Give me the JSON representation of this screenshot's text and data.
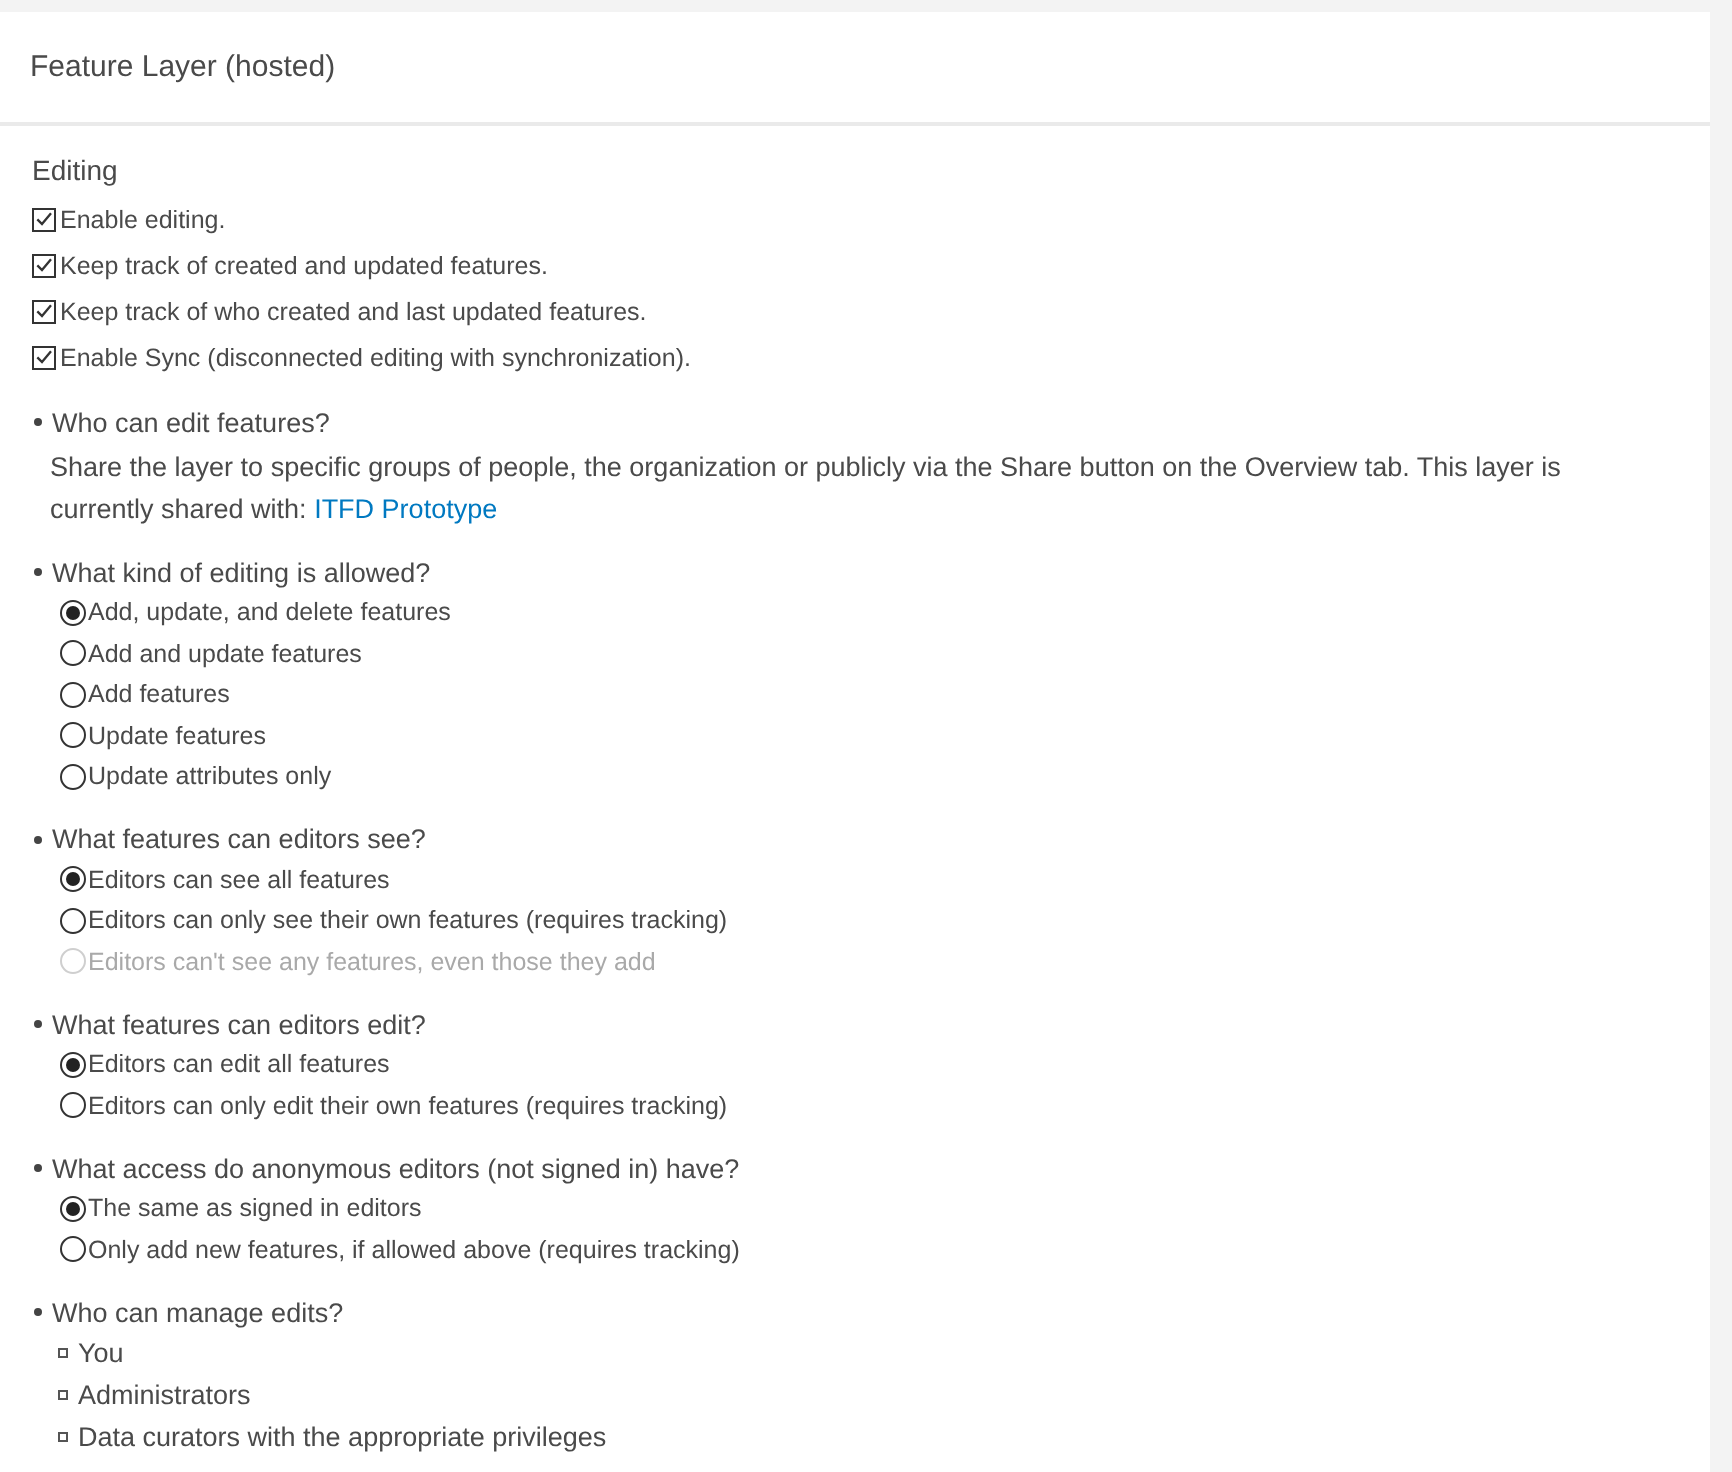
{
  "header": {
    "title": "Feature Layer (hosted)"
  },
  "editing": {
    "title": "Editing",
    "checkboxes": [
      {
        "label": "Enable editing.",
        "checked": true
      },
      {
        "label": "Keep track of created and updated features.",
        "checked": true
      },
      {
        "label": "Keep track of who created and last updated features.",
        "checked": true
      },
      {
        "label": "Enable Sync (disconnected editing with synchronization).",
        "checked": true
      }
    ]
  },
  "questions": [
    {
      "kind": "text",
      "question": "Who can edit features?",
      "description": "Share the layer to specific groups of people, the organization or publicly via the Share button on the Overview tab. This layer is currently shared with:",
      "link": "ITFD Prototype"
    },
    {
      "kind": "radios",
      "question": "What kind of editing is allowed?",
      "options": [
        {
          "label": "Add, update, and delete features",
          "selected": true,
          "disabled": false
        },
        {
          "label": "Add and update features",
          "selected": false,
          "disabled": false
        },
        {
          "label": "Add features",
          "selected": false,
          "disabled": false
        },
        {
          "label": "Update features",
          "selected": false,
          "disabled": false
        },
        {
          "label": "Update attributes only",
          "selected": false,
          "disabled": false
        }
      ]
    },
    {
      "kind": "radios",
      "question": "What features can editors see?",
      "options": [
        {
          "label": "Editors can see all features",
          "selected": true,
          "disabled": false
        },
        {
          "label": "Editors can only see their own features (requires tracking)",
          "selected": false,
          "disabled": false
        },
        {
          "label": "Editors can't see any features, even those they add",
          "selected": false,
          "disabled": true
        }
      ]
    },
    {
      "kind": "radios",
      "question": "What features can editors edit?",
      "options": [
        {
          "label": "Editors can edit all features",
          "selected": true,
          "disabled": false
        },
        {
          "label": "Editors can only edit their own features (requires tracking)",
          "selected": false,
          "disabled": false
        }
      ]
    },
    {
      "kind": "radios",
      "question": "What access do anonymous editors (not signed in) have?",
      "options": [
        {
          "label": "The same as signed in editors",
          "selected": true,
          "disabled": false
        },
        {
          "label": "Only add new features, if allowed above (requires tracking)",
          "selected": false,
          "disabled": false
        }
      ]
    },
    {
      "kind": "list",
      "question": "Who can manage edits?",
      "items": [
        "You",
        "Administrators",
        "Data curators with the appropriate privileges"
      ]
    }
  ]
}
